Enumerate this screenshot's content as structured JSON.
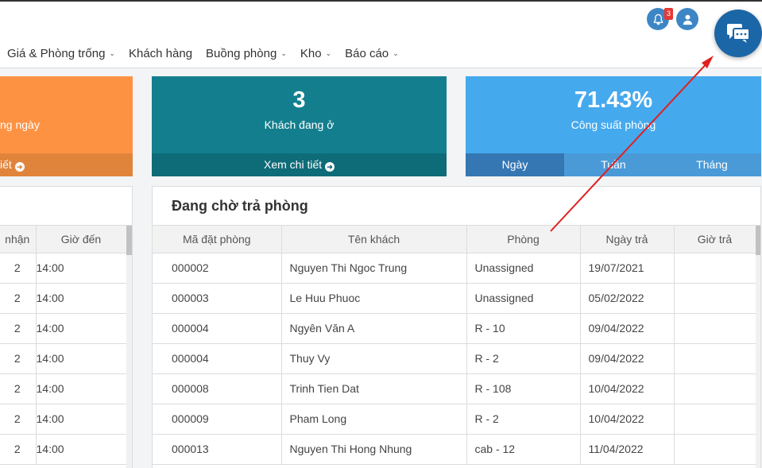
{
  "nav": {
    "items": [
      {
        "label": "Giá & Phòng trống",
        "dropdown": true
      },
      {
        "label": "Khách hàng",
        "dropdown": false
      },
      {
        "label": "Buồng phòng",
        "dropdown": true
      },
      {
        "label": "Kho",
        "dropdown": true
      },
      {
        "label": "Báo cáo",
        "dropdown": true
      }
    ]
  },
  "header": {
    "notification_count": "3",
    "icons": [
      "bell-icon",
      "user-icon",
      "chat-icon"
    ]
  },
  "cards": {
    "card1": {
      "label": "ng ngày",
      "footer": "iết"
    },
    "card2": {
      "value": "3",
      "label": "Khách đang ở",
      "footer": "Xem chi tiết"
    },
    "card3": {
      "value": "71.43%",
      "label": "Công suất phòng",
      "tabs": [
        "Ngày",
        "Tuần",
        "Tháng"
      ],
      "active_tab": "Ngày"
    }
  },
  "left_table": {
    "headers": [
      "nhận",
      "Giờ đến"
    ],
    "rows": [
      [
        "2",
        "14:00"
      ],
      [
        "2",
        "14:00"
      ],
      [
        "2",
        "14:00"
      ],
      [
        "2",
        "14:00"
      ],
      [
        "2",
        "14:00"
      ],
      [
        "2",
        "14:00"
      ],
      [
        "2",
        "14:00"
      ]
    ]
  },
  "checkout": {
    "title": "Đang chờ trả phòng",
    "headers": [
      "Mã đặt phòng",
      "Tên khách",
      "Phòng",
      "Ngày trả",
      "Giờ trả"
    ],
    "rows": [
      [
        "000002",
        "Nguyen Thi Ngoc Trung",
        "Unassigned",
        "19/07/2021",
        ""
      ],
      [
        "000003",
        "Le Huu Phuoc",
        "Unassigned",
        "05/02/2022",
        ""
      ],
      [
        "000004",
        "Ngyên Văn A",
        "R - 10",
        "09/04/2022",
        ""
      ],
      [
        "000004",
        "Thuy Vy",
        "R - 2",
        "09/04/2022",
        ""
      ],
      [
        "000008",
        "Trinh Tien Dat",
        "R - 108",
        "10/04/2022",
        ""
      ],
      [
        "000009",
        "Pham Long",
        "R - 2",
        "10/04/2022",
        ""
      ],
      [
        "000013",
        "Nguyen Thi Hong Nhung",
        "cab - 12",
        "11/04/2022",
        ""
      ]
    ]
  },
  "colors": {
    "orange": "#fe9243",
    "teal": "#137f8e",
    "blue": "#45a9ee",
    "chat": "#1b66a6",
    "annotation_arrow": "#e02020"
  }
}
